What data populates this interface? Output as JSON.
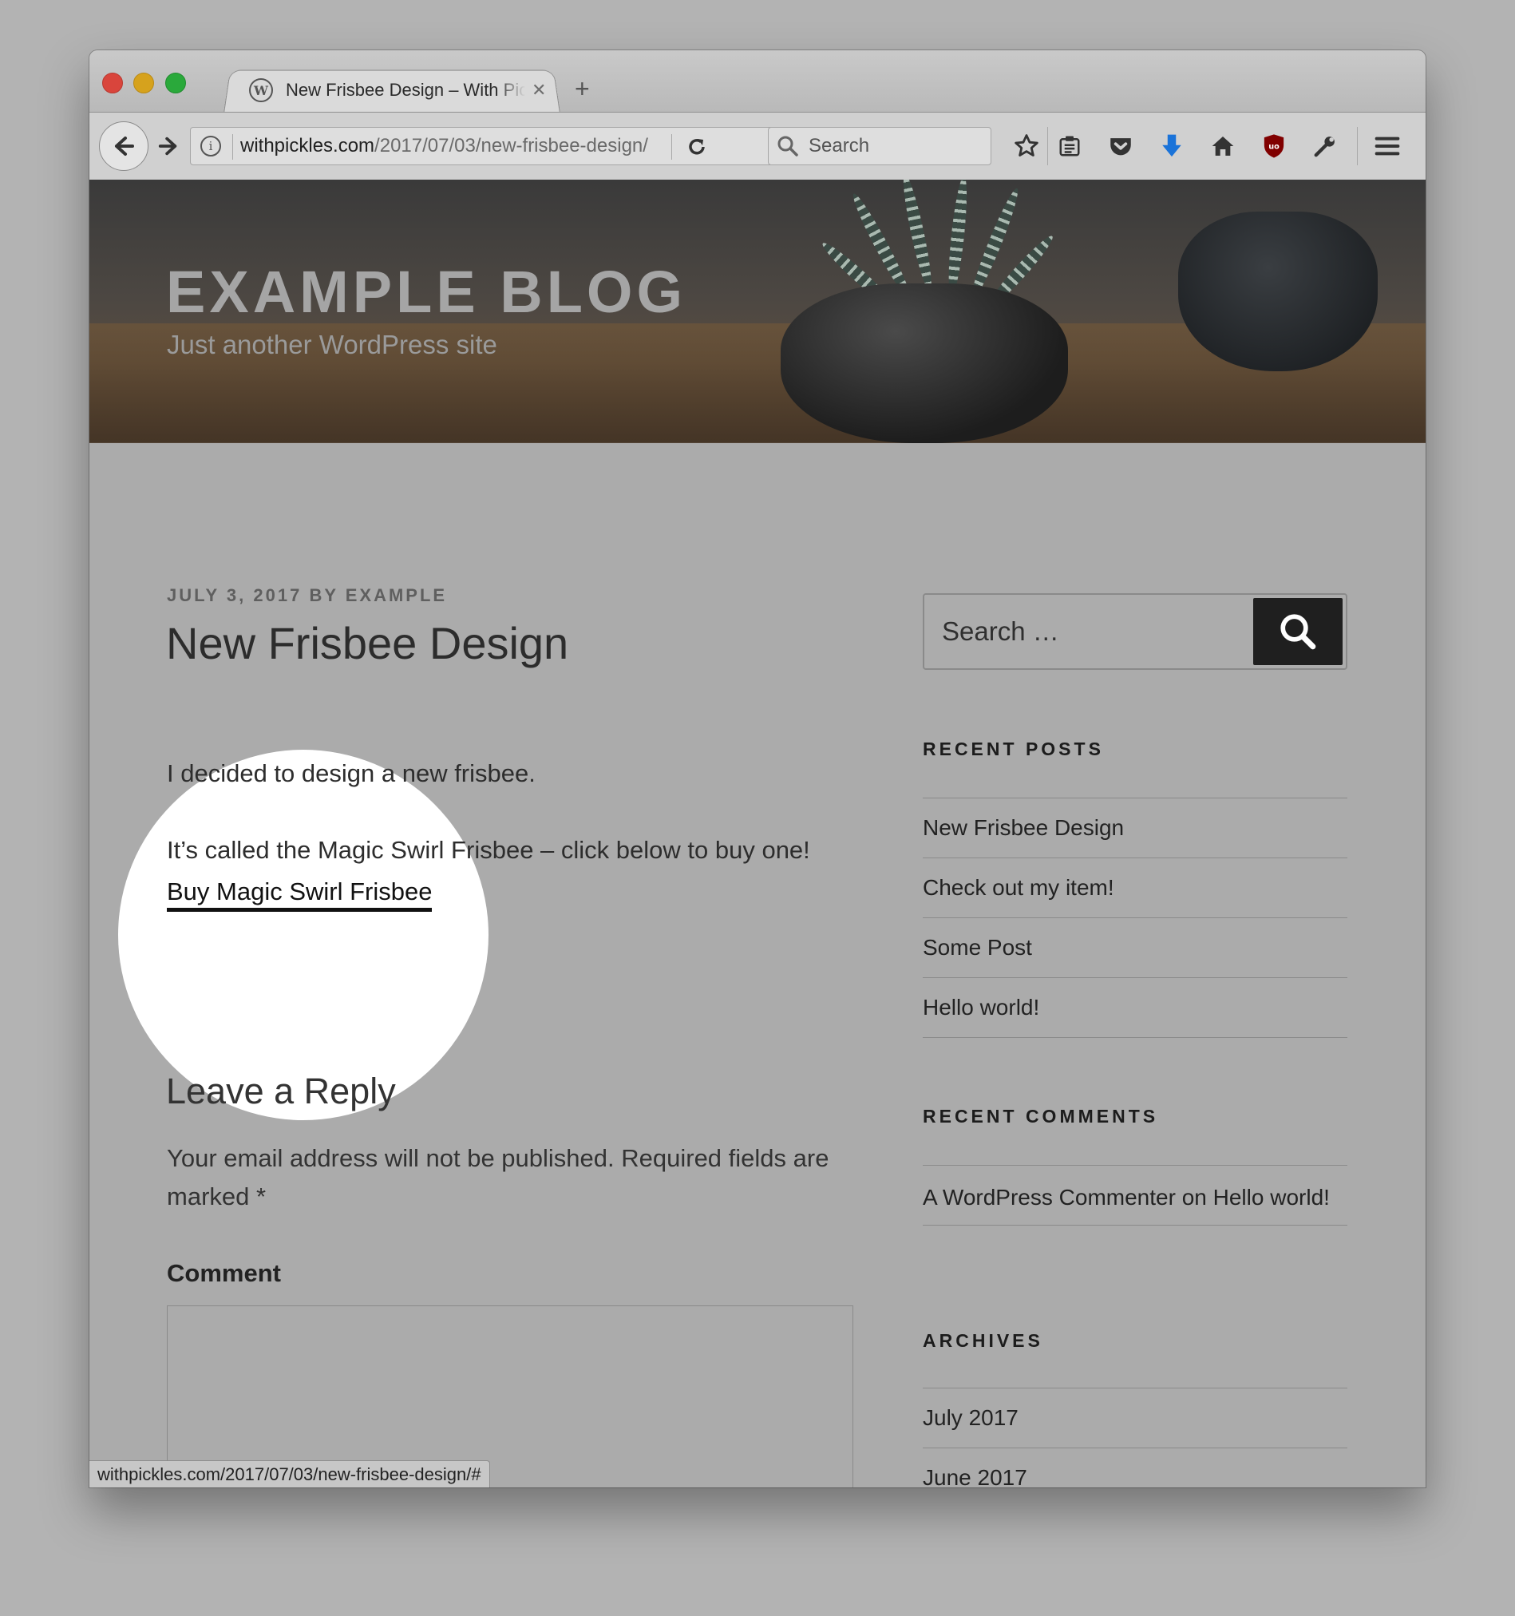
{
  "browser": {
    "tab": {
      "title": "New Frisbee Design – With Pickles",
      "close_glyph": "✕"
    },
    "new_tab_glyph": "+",
    "url": {
      "domain": "withpickles.com",
      "path": "/2017/07/03/new-frisbee-design/"
    },
    "search_placeholder": "Search",
    "status_url": "withpickles.com/2017/07/03/new-frisbee-design/#",
    "toolbar_icons": [
      "star-icon",
      "reading-list-icon",
      "pocket-icon",
      "download-icon",
      "home-icon",
      "ublock-icon",
      "wrench-icon",
      "hamburger-menu-icon"
    ],
    "colors": {
      "download_icon": "#1a73d9",
      "ublock_icon": "#800000"
    }
  },
  "site": {
    "title": "EXAMPLE BLOG",
    "description": "Just another WordPress site"
  },
  "post": {
    "meta": "JULY 3, 2017 BY EXAMPLE",
    "title": "New Frisbee Design",
    "paragraphs": [
      "I decided to design a new frisbee.",
      "It’s called the Magic Swirl Frisbee – click below to buy one!"
    ],
    "buy_link": "Buy Magic Swirl Frisbee"
  },
  "reply": {
    "title": "Leave a Reply",
    "note": "Your email address will not be published. Required fields are marked *",
    "comment_label": "Comment"
  },
  "sidebar": {
    "search_placeholder": "Search …",
    "recent_posts": {
      "title": "RECENT POSTS",
      "items": [
        "New Frisbee Design",
        "Check out my item!",
        "Some Post",
        "Hello world!"
      ]
    },
    "recent_comments": {
      "title": "RECENT COMMENTS",
      "items": [
        {
          "author": "A WordPress Commenter",
          "on": "on",
          "post": "Hello world!"
        }
      ]
    },
    "archives": {
      "title": "ARCHIVES",
      "items": [
        "July 2017",
        "June 2017"
      ]
    }
  }
}
